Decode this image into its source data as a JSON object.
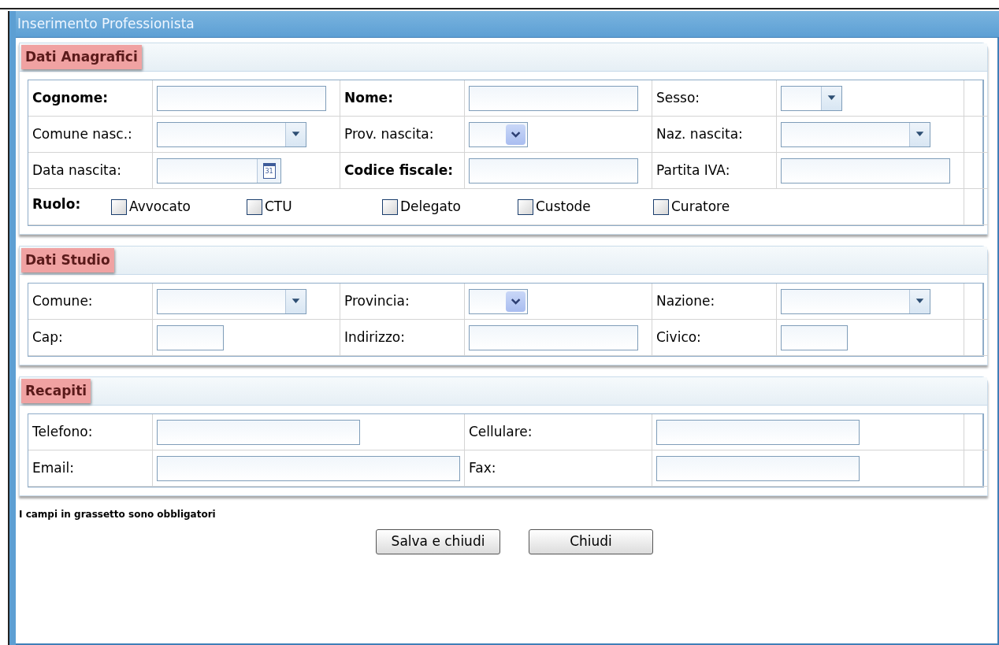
{
  "window": {
    "title": "Inserimento Professionista"
  },
  "sections": [
    {
      "title": "Dati Anagrafici",
      "rows": [
        {
          "kind": "fields",
          "cells": [
            {
              "label": "Cognome:",
              "required": true,
              "kind": "text"
            },
            {
              "label": "Nome:",
              "required": true,
              "kind": "text"
            },
            {
              "label": "Sesso:",
              "required": false,
              "kind": "short-combo"
            }
          ]
        },
        {
          "kind": "fields",
          "cells": [
            {
              "label": "Comune nasc.:",
              "required": false,
              "kind": "combo"
            },
            {
              "label": "Prov. nascita:",
              "required": false,
              "kind": "dropdown"
            },
            {
              "label": "Naz. nascita:",
              "required": false,
              "kind": "combo"
            }
          ]
        },
        {
          "kind": "fields",
          "cells": [
            {
              "label": "Data nascita:",
              "required": false,
              "kind": "date",
              "calendar_day": "31"
            },
            {
              "label": "Codice fiscale:",
              "required": true,
              "kind": "text"
            },
            {
              "label": "Partita IVA:",
              "required": false,
              "kind": "text"
            }
          ]
        },
        {
          "kind": "checkboxes",
          "label": "Ruolo:",
          "required": true,
          "options": [
            {
              "label": "Avvocato",
              "checked": false
            },
            {
              "label": "CTU",
              "checked": false
            },
            {
              "label": "Delegato",
              "checked": false
            },
            {
              "label": "Custode",
              "checked": false
            },
            {
              "label": "Curatore",
              "checked": false
            }
          ]
        }
      ]
    },
    {
      "title": "Dati Studio",
      "rows": [
        {
          "kind": "fields",
          "cells": [
            {
              "label": "Comune:",
              "required": false,
              "kind": "combo"
            },
            {
              "label": "Provincia:",
              "required": false,
              "kind": "dropdown"
            },
            {
              "label": "Nazione:",
              "required": false,
              "kind": "combo"
            }
          ]
        },
        {
          "kind": "fields",
          "cells": [
            {
              "label": "Cap:",
              "required": false,
              "kind": "short-text"
            },
            {
              "label": "Indirizzo:",
              "required": false,
              "kind": "text"
            },
            {
              "label": "Civico:",
              "required": false,
              "kind": "short-text"
            }
          ]
        }
      ]
    },
    {
      "title": "Recapiti",
      "rows": [
        {
          "kind": "fields",
          "cells": [
            {
              "label": "Telefono:",
              "required": false,
              "kind": "wide-text"
            },
            {
              "label": "Cellulare:",
              "required": false,
              "kind": "wide-text"
            }
          ]
        },
        {
          "kind": "fields",
          "cells": [
            {
              "label": "Email:",
              "required": false,
              "kind": "long-text"
            },
            {
              "label": "Fax:",
              "required": false,
              "kind": "wide-text"
            }
          ]
        }
      ]
    }
  ],
  "note": "I campi in grassetto sono obbligatori",
  "buttons": [
    "Salva e chiudi",
    "Chiudi"
  ]
}
